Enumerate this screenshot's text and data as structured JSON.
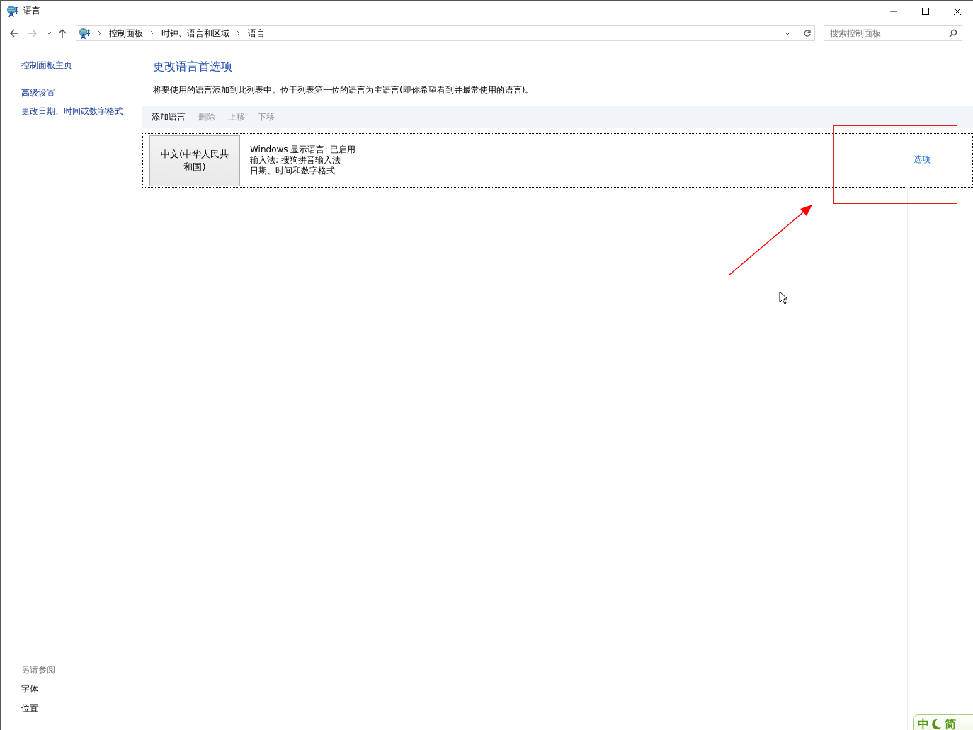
{
  "window": {
    "title": "语言"
  },
  "address_bar": {
    "breadcrumbs": [
      "控制面板",
      "时钟、语言和区域",
      "语言"
    ]
  },
  "search": {
    "placeholder": "搜索控制面板"
  },
  "sidebar": {
    "items": [
      {
        "label": "控制面板主页"
      },
      {
        "label": "高级设置"
      },
      {
        "label": "更改日期、时间或数字格式"
      }
    ],
    "see_also": {
      "heading": "另请参阅",
      "items": [
        {
          "label": "字体"
        },
        {
          "label": "位置"
        }
      ]
    }
  },
  "main": {
    "title": "更改语言首选项",
    "description": "将要使用的语言添加到此列表中。位于列表第一位的语言为主语言(即你希望看到并最常使用的语言)。",
    "toolbar": [
      {
        "label": "添加语言",
        "disabled": false
      },
      {
        "label": "删除",
        "disabled": true
      },
      {
        "label": "上移",
        "disabled": true
      },
      {
        "label": "下移",
        "disabled": true
      }
    ],
    "languages": [
      {
        "name": "中文(中华人民共和国)",
        "details": [
          "Windows 显示语言: 已启用",
          "输入法: 搜狗拼音输入法",
          "日期、时间和数字格式"
        ],
        "options_link": "选项"
      }
    ]
  },
  "ime_bar": {
    "items": [
      "中",
      "简"
    ]
  }
}
